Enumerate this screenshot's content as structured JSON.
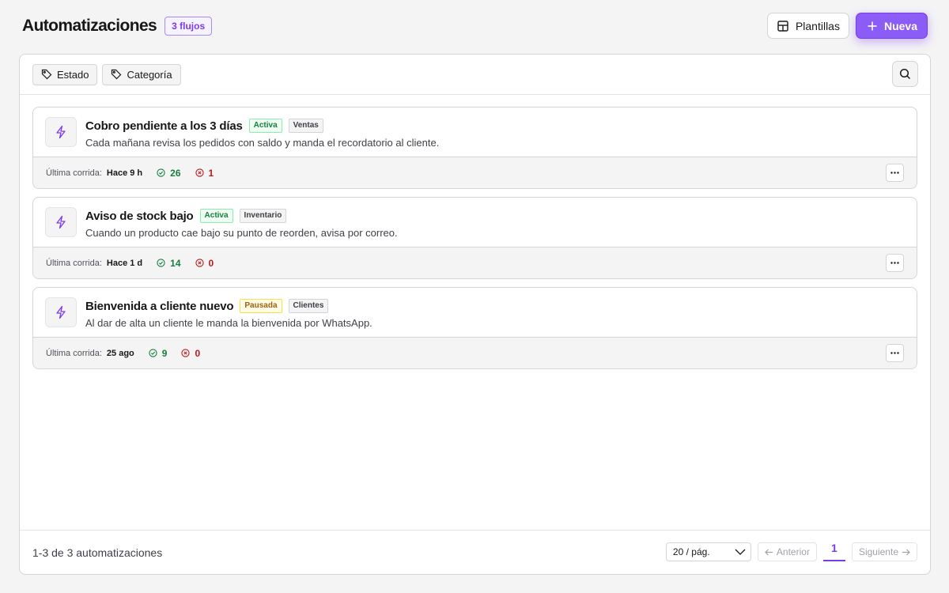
{
  "header": {
    "title": "Automatizaciones",
    "count_badge": "3 flujos",
    "templates_label": "Plantillas",
    "new_label": "Nueva"
  },
  "filters": [
    {
      "label": "Estado",
      "icon": "tag-icon"
    },
    {
      "label": "Categoría",
      "icon": "tag-icon"
    }
  ],
  "cards": [
    {
      "title": "Cobro pendiente a los 3 días",
      "status": "Activa",
      "category": "Ventas",
      "description": "Cada mañana revisa los pedidos con saldo y manda el recordatorio al cliente.",
      "last_run_label": "Última corrida:",
      "last_run": "Hace 9 h",
      "ok_count": "26",
      "error_count": "1"
    },
    {
      "title": "Aviso de stock bajo",
      "status": "Activa",
      "category": "Inventario",
      "description": "Cuando un producto cae bajo su punto de reorden, avisa por correo.",
      "last_run_label": "Última corrida:",
      "last_run": "Hace 1 d",
      "ok_count": "14",
      "error_count": "0"
    },
    {
      "title": "Bienvenida a cliente nuevo",
      "status": "Pausada",
      "category": "Clientes",
      "description": "Al dar de alta un cliente le manda la bienvenida por WhatsApp.",
      "last_run_label": "Última corrida:",
      "last_run": "25 ago",
      "ok_count": "9",
      "error_count": "0"
    }
  ],
  "footer": {
    "summary": "1-3 de 3 automatizaciones",
    "page_size": "20 / pág.",
    "prev_label": "Anterior",
    "next_label": "Siguiente",
    "current_page": "1"
  },
  "colors": {
    "accent": "#8b5cf6",
    "active": "#15803d",
    "paused": "#a16207",
    "error": "#b91c1c"
  }
}
